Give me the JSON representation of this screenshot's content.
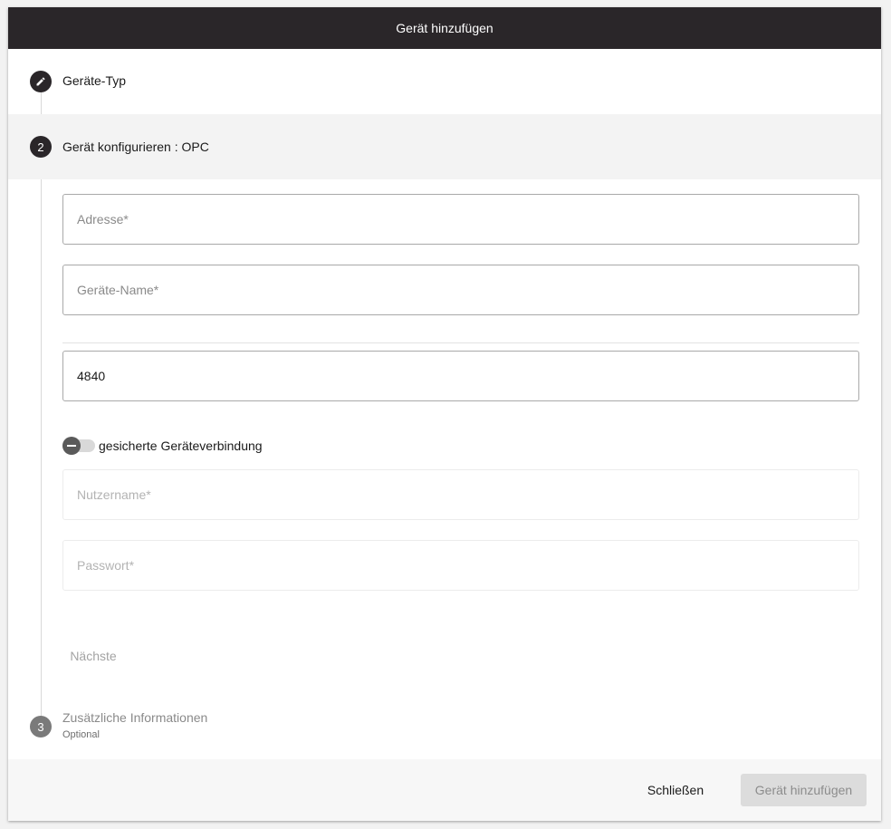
{
  "dialog": {
    "title": "Gerät hinzufügen"
  },
  "steps": [
    {
      "number": "",
      "icon": "pencil-icon",
      "label": "Geräte-Typ",
      "state": "done"
    },
    {
      "number": "2",
      "label": "Gerät konfigurieren : OPC",
      "state": "active"
    },
    {
      "number": "3",
      "label": "Zusätzliche Informationen",
      "sublabel": "Optional",
      "state": "inactive"
    }
  ],
  "form": {
    "address": {
      "placeholder": "Adresse*",
      "value": ""
    },
    "device_name": {
      "placeholder": "Geräte-Name*",
      "value": ""
    },
    "port": {
      "placeholder": "",
      "value": "4840"
    },
    "secure_toggle": {
      "label": "gesicherte Geräteverbindung",
      "checked": false
    },
    "username": {
      "placeholder": "Nutzername*",
      "value": ""
    },
    "password": {
      "placeholder": "Passwort*",
      "value": ""
    },
    "next_label": "Nächste"
  },
  "footer": {
    "close_label": "Schließen",
    "add_label": "Gerät hinzufügen"
  },
  "colors": {
    "titlebar": "#2a2629",
    "active_step_bg": "#f3f3f3",
    "disabled_button_bg": "#dcdcdc"
  }
}
